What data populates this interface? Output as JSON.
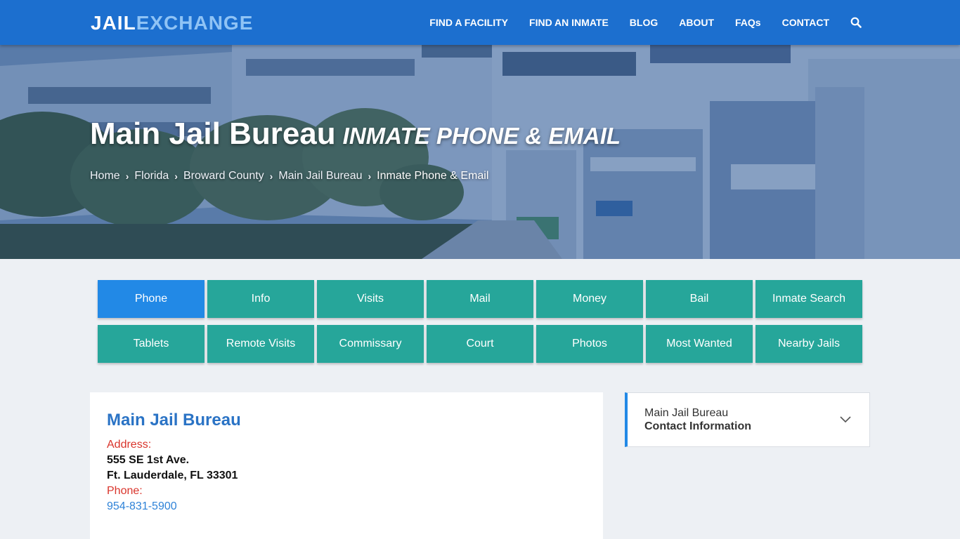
{
  "logo": {
    "part1": "JAIL",
    "part2": "EXCHANGE"
  },
  "nav": {
    "items": [
      "FIND A FACILITY",
      "FIND AN INMATE",
      "BLOG",
      "ABOUT",
      "FAQs",
      "CONTACT"
    ],
    "search_icon": "search-icon"
  },
  "hero": {
    "title": "Main Jail Bureau",
    "subtitle": "INMATE PHONE & EMAIL",
    "breadcrumb": [
      "Home",
      "Florida",
      "Broward County",
      "Main Jail Bureau",
      "Inmate Phone & Email"
    ]
  },
  "buttons": {
    "row1": [
      "Phone",
      "Info",
      "Visits",
      "Mail",
      "Money",
      "Bail",
      "Inmate Search"
    ],
    "row2": [
      "Tablets",
      "Remote Visits",
      "Commissary",
      "Court",
      "Photos",
      "Most Wanted",
      "Nearby Jails"
    ],
    "active": "Phone"
  },
  "facility": {
    "name": "Main Jail Bureau",
    "address_label": "Address:",
    "address_line1": "555 SE 1st Ave.",
    "address_line2": "Ft. Lauderdale, FL 33301",
    "phone_label": "Phone:",
    "phone": "954-831-5900"
  },
  "sidebar": {
    "line1": "Main Jail Bureau",
    "line2": "Contact Information"
  },
  "colors": {
    "nav_bg": "#1c6fcf",
    "button_teal": "#26a69a",
    "button_active": "#2289e6",
    "label_red": "#d9342b",
    "link_blue": "#2f83d8"
  }
}
